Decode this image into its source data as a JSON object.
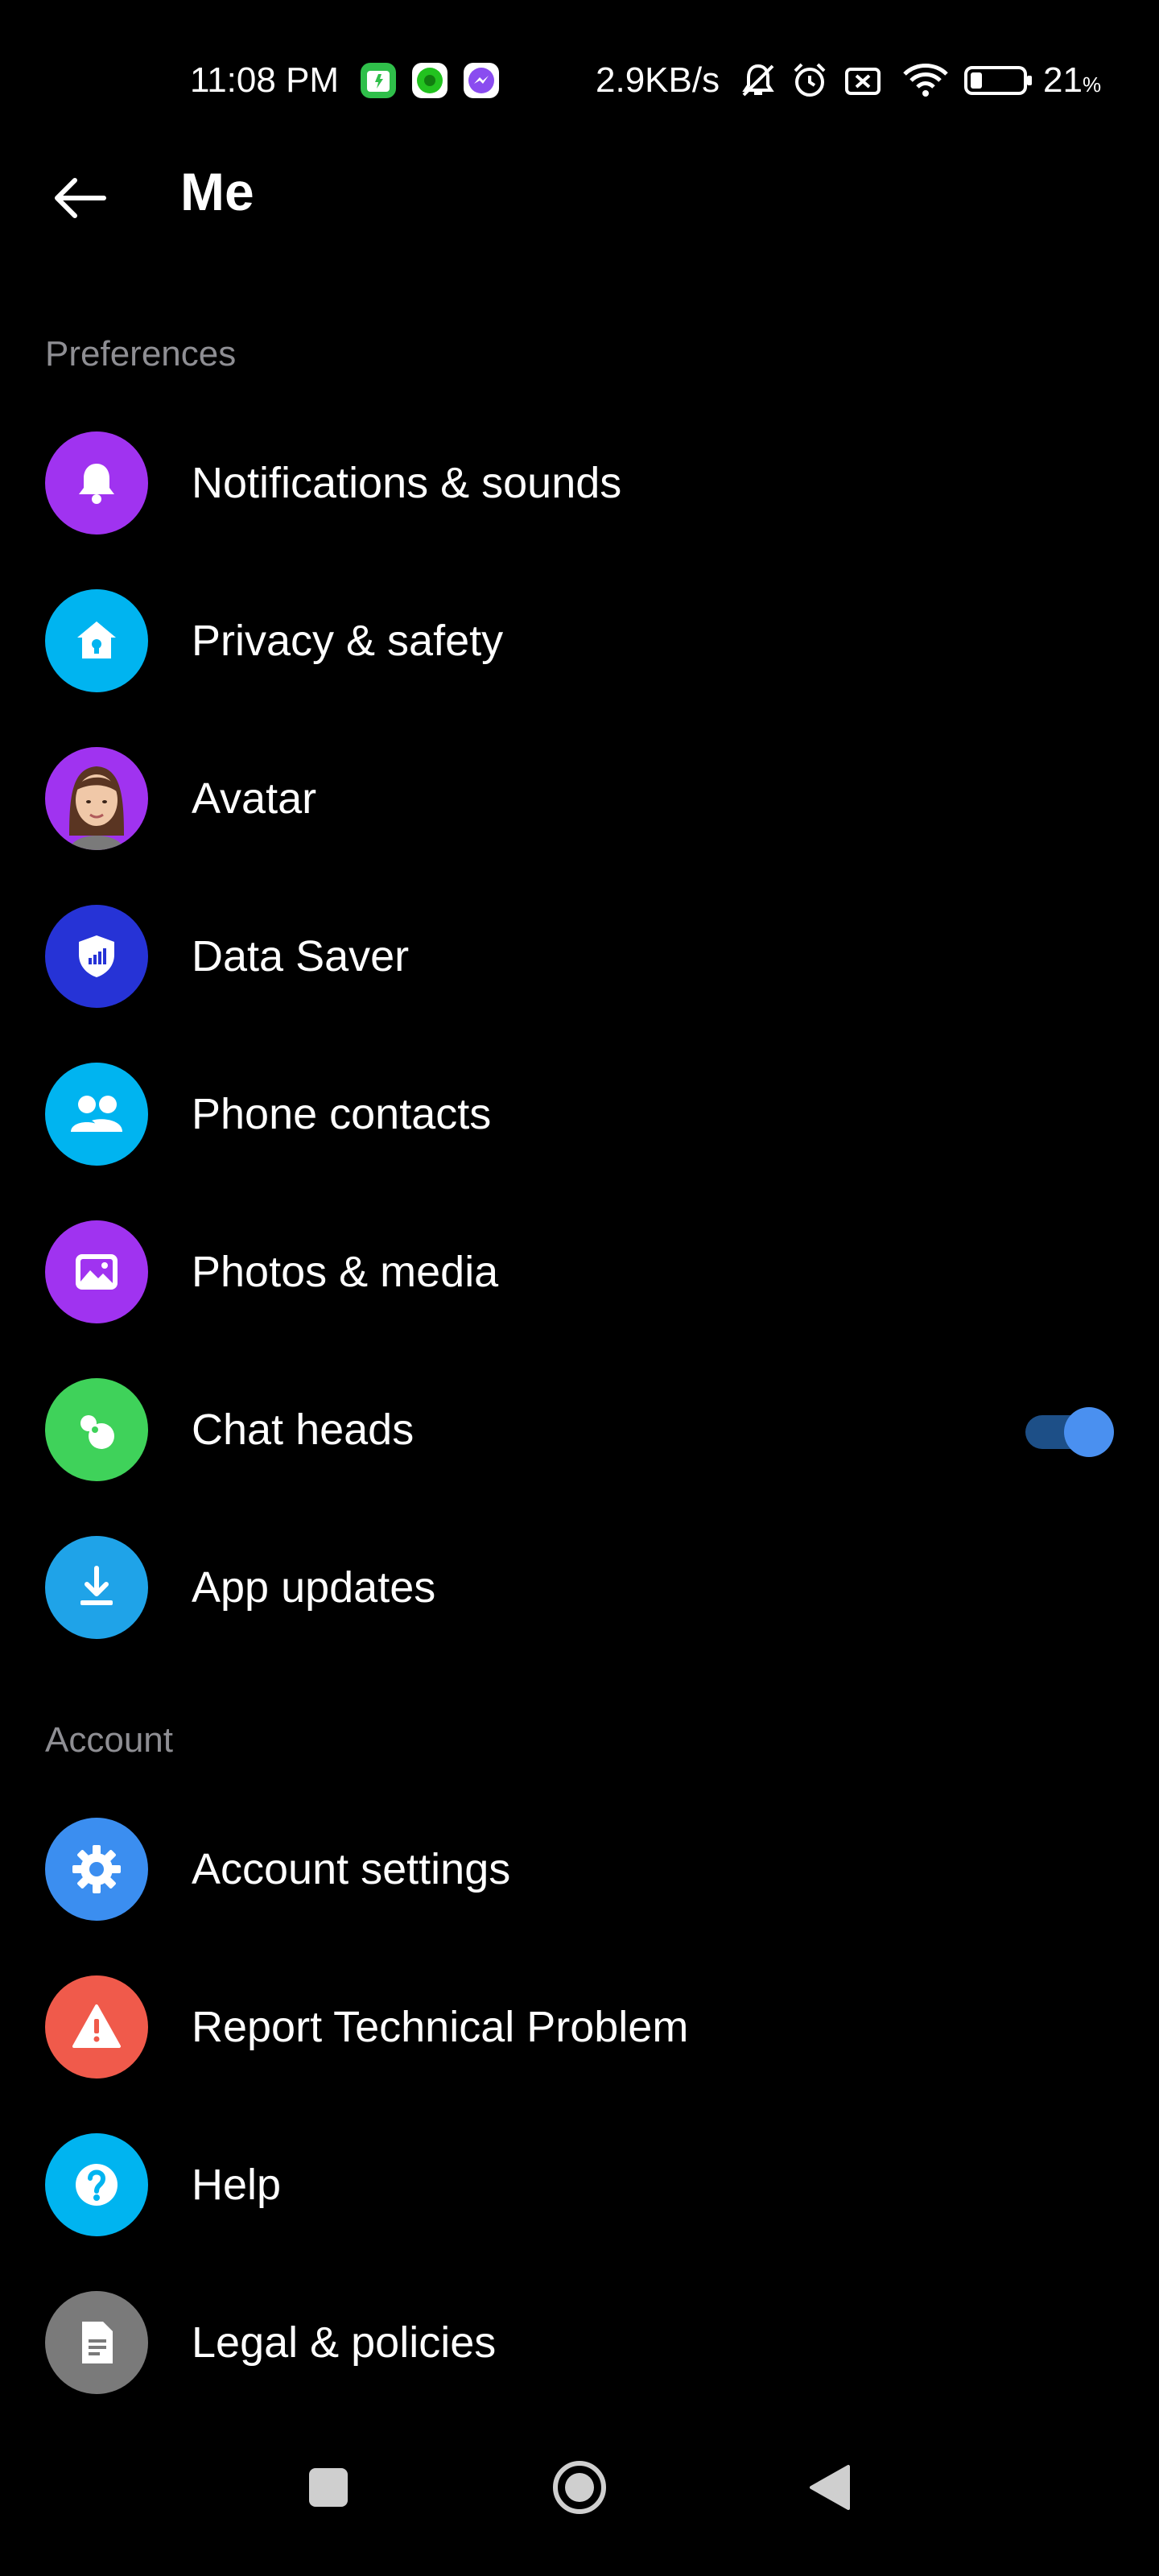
{
  "status_bar": {
    "time": "11:08 PM",
    "net_speed": "2.9KB/s",
    "battery": "21",
    "battery_unit": "%",
    "icons": [
      "app-security-icon",
      "app-green-icon",
      "messenger-icon",
      "mute-icon",
      "alarm-icon",
      "sim-off-icon",
      "wifi-icon",
      "battery-icon"
    ]
  },
  "header": {
    "title": "Me",
    "back_icon": "arrow-left-icon"
  },
  "preferences": {
    "title": "Preferences",
    "items": [
      {
        "label": "Notifications & sounds",
        "icon": "bell-icon",
        "color": "#a033f0"
      },
      {
        "label": "Privacy & safety",
        "icon": "house-lock-icon",
        "color": "#00b4f0"
      },
      {
        "label": "Avatar",
        "icon": "avatar-icon",
        "color": "#a033f0"
      },
      {
        "label": "Data Saver",
        "icon": "shield-signal-icon",
        "color": "#2633d6"
      },
      {
        "label": "Phone contacts",
        "icon": "people-icon",
        "color": "#00b4f0"
      },
      {
        "label": "Photos & media",
        "icon": "photo-icon",
        "color": "#a033f0"
      },
      {
        "label": "Chat heads",
        "icon": "chat-heads-icon",
        "color": "#3fd25a",
        "toggle": true
      },
      {
        "label": "App updates",
        "icon": "download-icon",
        "color": "#1fa3e8"
      }
    ]
  },
  "account": {
    "title": "Account",
    "items": [
      {
        "label": "Account settings",
        "icon": "gear-icon",
        "color": "#3b8ef0"
      },
      {
        "label": "Report Technical Problem",
        "icon": "warning-icon",
        "color": "#f05a4b"
      },
      {
        "label": "Help",
        "icon": "question-icon",
        "color": "#00b4f0"
      },
      {
        "label": "Legal & policies",
        "icon": "document-icon",
        "color": "#7a7a7a"
      }
    ]
  },
  "nav": {
    "icons": [
      "recents-square-icon",
      "home-circle-icon",
      "back-triangle-icon"
    ]
  }
}
